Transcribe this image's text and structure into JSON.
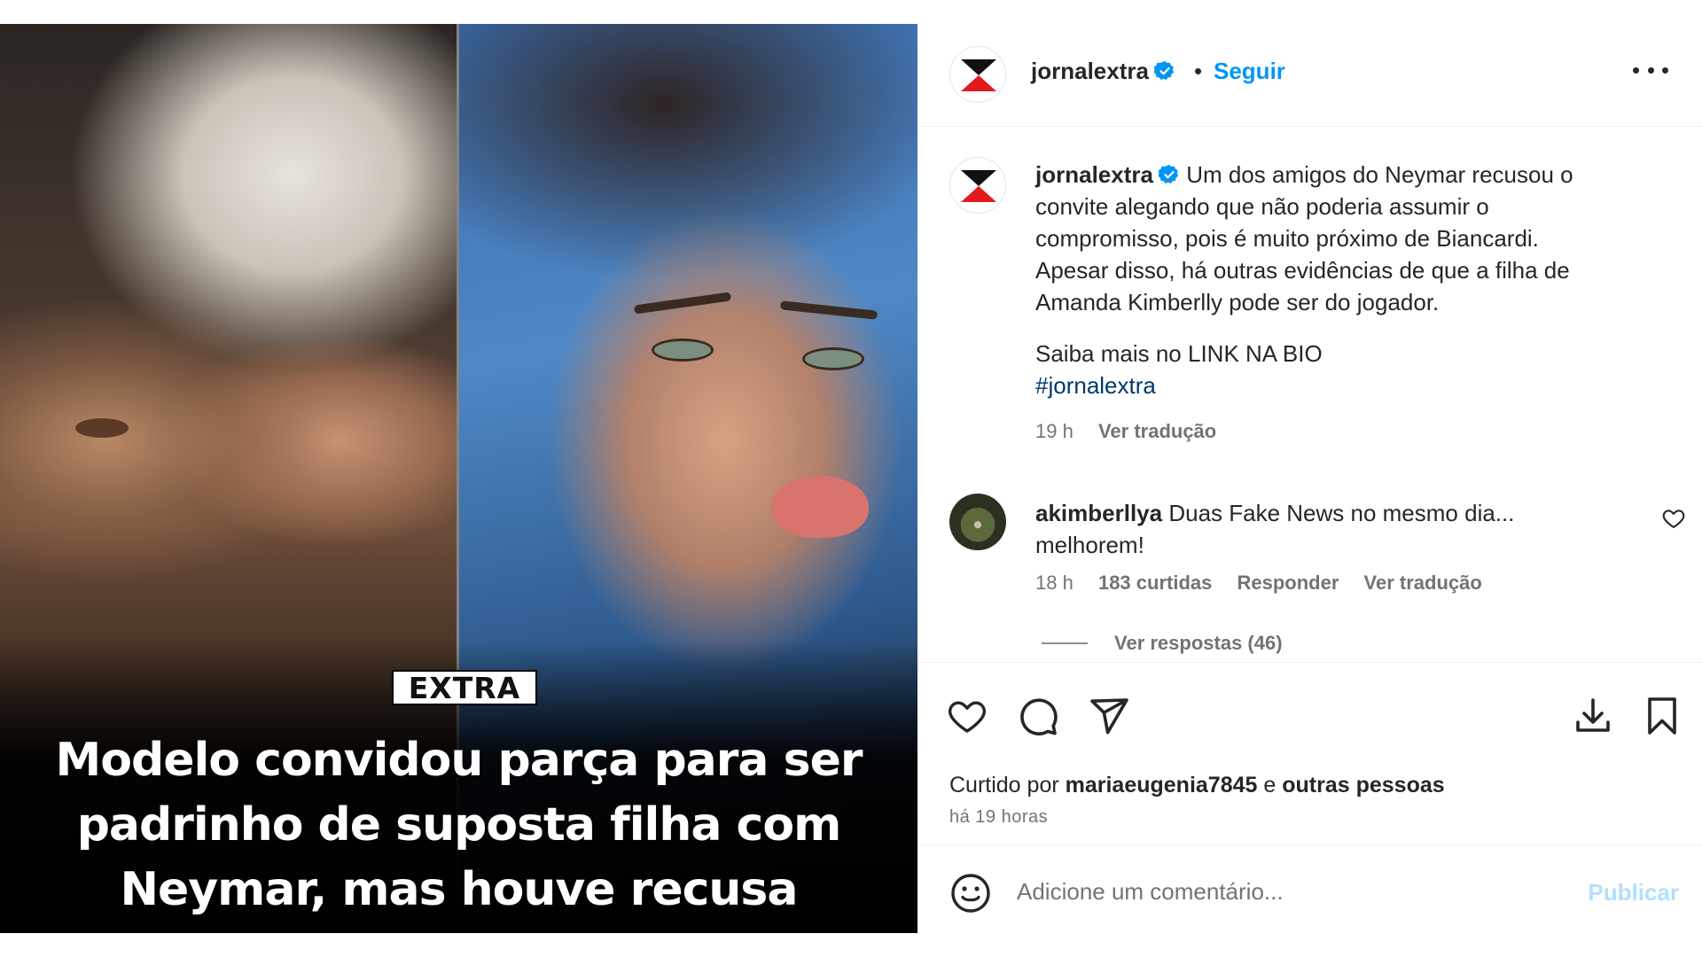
{
  "media": {
    "brand": "EXTRA",
    "headline_lines": [
      "Modelo convidou parça para ser",
      "padrinho de suposta filha com",
      "Neymar, mas houve recusa"
    ]
  },
  "header": {
    "username": "jornalextra",
    "separator": "•",
    "follow_label": "Seguir",
    "more_icon": "more-horizontal-icon"
  },
  "caption": {
    "username": "jornalextra",
    "text_lines": [
      "Um dos amigos do Neymar recusou o",
      "convite alegando que não poderia assumir o",
      "compromisso, pois é muito próximo de Biancardi.",
      "Apesar disso, há outras evidências de que a filha de",
      "Amanda Kimberlly pode ser do jogador."
    ],
    "more_info": "Saiba mais no LINK NA BIO",
    "hashtag": "#jornalextra",
    "time": "19 h",
    "translate": "Ver tradução"
  },
  "comment": {
    "username": "akimberllya",
    "text_first": "Duas Fake News no mesmo dia...",
    "text_second": "melhorem!",
    "time": "18 h",
    "likes": "183 curtidas",
    "reply": "Responder",
    "translate": "Ver tradução",
    "view_replies": "Ver respostas (46)"
  },
  "actions": {
    "liked_by_prefix": "Curtido por",
    "liked_by_user": "mariaeugenia7845",
    "liked_by_conj": "e",
    "liked_by_others": "outras pessoas",
    "time_ago": "há 19 horas"
  },
  "add_comment": {
    "placeholder": "Adicione um comentário...",
    "publish": "Publicar"
  },
  "colors": {
    "accent": "#0095f6",
    "publish_disabled": "#b2dffc",
    "hashtag": "#00376b",
    "muted": "#737373",
    "logo_red": "#e3191c"
  }
}
